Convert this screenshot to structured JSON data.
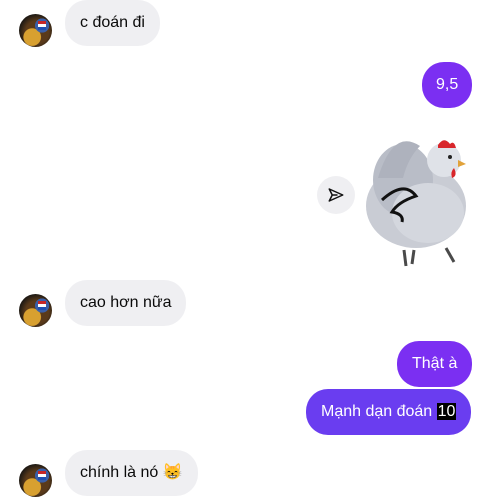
{
  "messages": {
    "m1": "c đoán đi",
    "m2": "9,5",
    "m3": "cao hơn nữa",
    "m4": "Thật à",
    "m5_text": "Mạnh dạn đoán ",
    "m5_hl": "10",
    "m6": "chính là nó 😸"
  },
  "colors": {
    "outgoing_bubble": "#7b2ff2",
    "incoming_bubble": "#efeff2"
  },
  "icons": {
    "share": "send-icon",
    "sticker": "chicken-sticker"
  }
}
